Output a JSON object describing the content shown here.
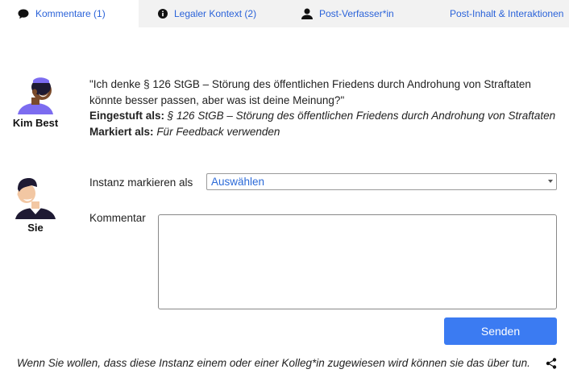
{
  "tabs": [
    {
      "label": "Kommentare (1)",
      "icon": "comment-icon",
      "active": true
    },
    {
      "label": "Legaler Kontext (2)",
      "icon": "info-icon",
      "active": false
    },
    {
      "label": "Post-Verfasser*in",
      "icon": "person-icon",
      "active": false
    },
    {
      "label": "Post-Inhalt & Interaktionen",
      "icon": "",
      "active": false
    }
  ],
  "comment": {
    "author": "Kim Best",
    "text": "\"Ich denke § 126 StGB – Störung des öffentlichen Friedens durch Androhung von Straftaten könnte besser passen, aber was ist deine Meinung?\"",
    "classified_label": "Eingestuft als:",
    "classified_value": "§ 126 StGB – Störung des öffentlichen Friedens durch Androhung von Straftaten",
    "marked_label": "Markiert als:",
    "marked_value": "Für Feedback verwenden"
  },
  "reply": {
    "author": "Sie",
    "mark_label": "Instanz markieren als",
    "mark_select_value": "Auswählen",
    "comment_label": "Kommentar",
    "comment_value": "",
    "send_label": "Senden"
  },
  "hint": "Wenn Sie wollen, dass diese Instanz einem oder einer Kolleg*in zugewiesen wird können sie das über tun.",
  "colors": {
    "accent": "#2b63d9",
    "button": "#3b7bf2",
    "tab_inactive_bg": "#f2f2f2"
  }
}
